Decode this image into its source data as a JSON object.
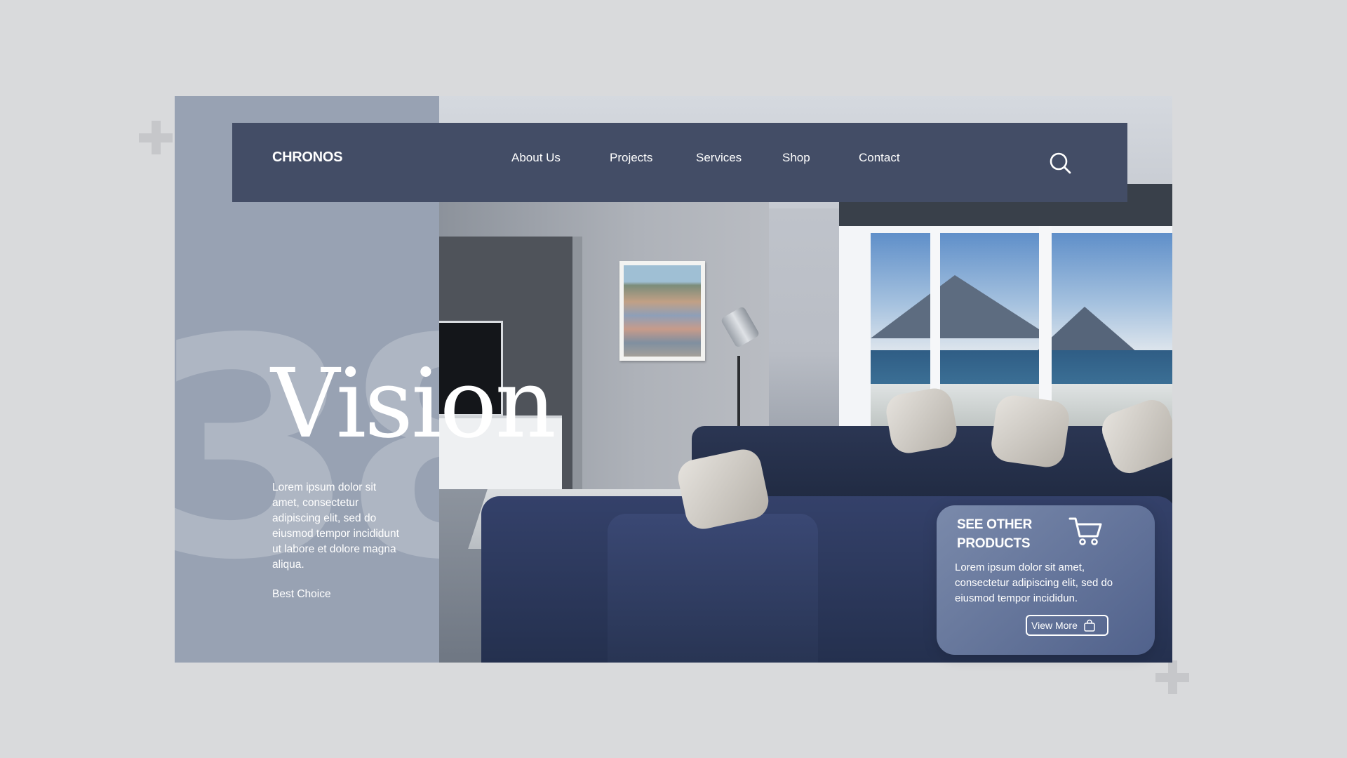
{
  "brand": {
    "logo_text": "CHRONOS"
  },
  "nav": {
    "items": [
      {
        "label": "About Us"
      },
      {
        "label": "Projects"
      },
      {
        "label": "Services"
      },
      {
        "label": "Shop"
      },
      {
        "label": "Contact"
      }
    ],
    "search_icon": "search-icon"
  },
  "hero": {
    "background_number": "38",
    "title": "Vision",
    "description": "Lorem ipsum dolor sit amet, consectetur adipiscing elit, sed do eiusmod tempor incididunt ut labore et dolore magna aliqua.",
    "tag": "Best Choice"
  },
  "promo": {
    "title": "SEE OTHER PRODUCTS",
    "icon": "cart-icon",
    "text": "Lorem ipsum dolor sit amet, consectetur adipiscing elit, sed do eiusmod tempor incididun.",
    "button_label": "View More",
    "button_icon": "shopping-bag-icon"
  },
  "colors": {
    "page_bg": "#d9dadc",
    "nav_bg": "#434d66",
    "left_panel": "#98a2b3",
    "promo_bg": "#6f7fa6",
    "text": "#ffffff"
  }
}
